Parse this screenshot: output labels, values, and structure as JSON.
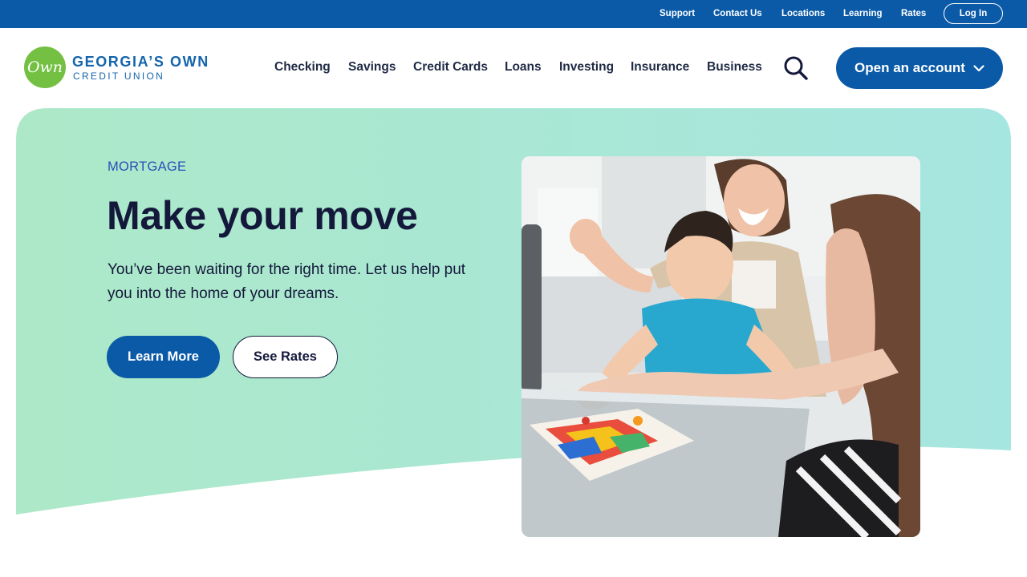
{
  "utility_nav": {
    "links": [
      "Support",
      "Contact Us",
      "Locations",
      "Learning",
      "Rates"
    ],
    "login_label": "Log In"
  },
  "brand": {
    "logo_mark": "Own",
    "name_line1": "GEORGIA’S OWN",
    "name_line2": "CREDIT UNION"
  },
  "main_nav": {
    "items": [
      "Checking",
      "Savings",
      "Credit Cards",
      "Loans",
      "Investing",
      "Insurance",
      "Business"
    ],
    "search_icon": "search-icon",
    "cta_label": "Open an account"
  },
  "hero": {
    "eyebrow": "MORTGAGE",
    "title": "Make your move",
    "body": "You’ve been waiting for the right time. Let us help put you into the home of your dreams.",
    "primary_button": "Learn More",
    "secondary_button": "See Rates"
  },
  "colors": {
    "brand_blue": "#0a5aa8",
    "logo_green": "#74c043",
    "hero_gradient_start": "#ade8c8",
    "hero_gradient_end": "#a6e6e0",
    "heading_navy": "#14193b"
  }
}
